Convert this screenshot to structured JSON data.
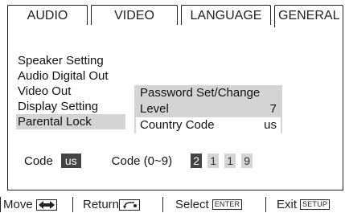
{
  "tabs": [
    {
      "label": "AUDIO",
      "active": false
    },
    {
      "label": "VIDEO",
      "active": false
    },
    {
      "label": "LANGUAGE",
      "active": false
    },
    {
      "label": "GENERAL",
      "active": true
    }
  ],
  "menu": {
    "items": [
      {
        "label": "Speaker Setting"
      },
      {
        "label": "Audio Digital Out"
      },
      {
        "label": "Video Out"
      },
      {
        "label": "Display Setting"
      },
      {
        "label": "Parental Lock",
        "selected": true
      }
    ]
  },
  "submenu": {
    "items": [
      {
        "label": "Password Set/Change",
        "value": ""
      },
      {
        "label": "Level",
        "value": "7"
      },
      {
        "label": "Country Code",
        "value": "us",
        "focused": true
      }
    ]
  },
  "code_row": {
    "code_label": "Code",
    "code_value": "us",
    "range_label": "Code (0~9)",
    "digits": [
      "2",
      "1",
      "1",
      "9"
    ]
  },
  "help_bar": {
    "move_label": "Move",
    "move_icon": "left-right-arrows-icon",
    "return_label": "Return",
    "return_icon": "return-icon",
    "select_label": "Select",
    "select_key": "ENTER",
    "exit_label": "Exit",
    "exit_key": "SETUP"
  },
  "colors": {
    "highlight": "#d4d4d4",
    "dark_box": "#444444"
  }
}
